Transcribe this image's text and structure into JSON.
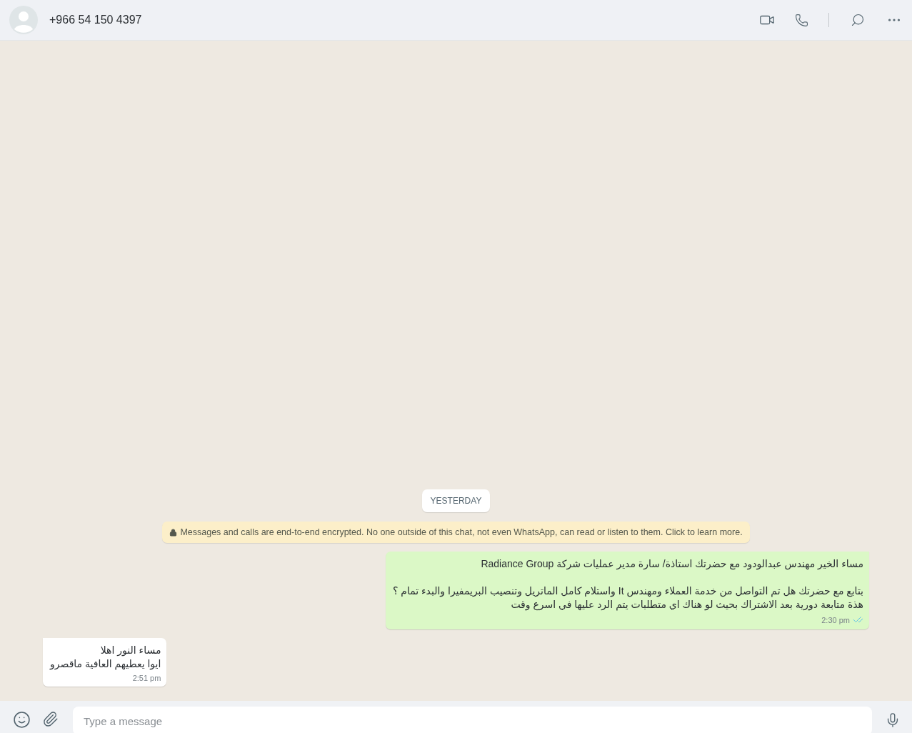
{
  "header": {
    "contact": "+966 54 150 4397"
  },
  "chat": {
    "date_label": "YESTERDAY",
    "encryption_notice": "Messages and calls are end-to-end encrypted. No one outside of this chat, not even WhatsApp, can read or listen to them. Click to learn more.",
    "messages": [
      {
        "kind": "outgoing",
        "paragraphs": [
          [
            "مساء الخير مهندس عبدالودود مع حضرتك استاذة/ سارة مدير عمليات شركة Radiance Group"
          ],
          [
            "بتابع مع حضرتك هل تم التواصل من خدمة العملاء ومهندس It واستلام كامل الماتريل وتنصيب البريمفيرا والبدء تمام ؟",
            "هذة متابعة دورية بعد الاشتراك بحيث لو هناك اي متطلبات يتم الرد عليها في اسرع وقت"
          ]
        ],
        "time": "2:30 pm",
        "read": true
      },
      {
        "kind": "incoming",
        "paragraphs": [
          [
            "مساء النور اهلا",
            "ايوا يعطيهم العافية ماقصرو"
          ]
        ],
        "time": "2:51 pm"
      }
    ]
  },
  "composer": {
    "placeholder": "Type a message"
  }
}
